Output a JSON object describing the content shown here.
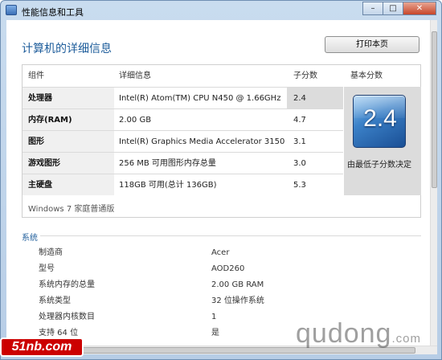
{
  "window": {
    "title": "性能信息和工具",
    "min": "–",
    "max": "□",
    "close": "✕"
  },
  "heading": "计算机的详细信息",
  "print_button": "打印本页",
  "table": {
    "headers": {
      "component": "组件",
      "details": "详细信息",
      "subscore": "子分数",
      "basescore": "基本分数"
    },
    "rows": [
      {
        "component": "处理器",
        "details": "Intel(R) Atom(TM) CPU N450 @ 1.66GHz",
        "subscore": "2.4"
      },
      {
        "component": "内存(RAM)",
        "details": "2.00 GB",
        "subscore": "4.7"
      },
      {
        "component": "图形",
        "details": "Intel(R) Graphics Media Accelerator 3150",
        "subscore": "3.1"
      },
      {
        "component": "游戏图形",
        "details": "256 MB 可用图形内存总量",
        "subscore": "3.0"
      },
      {
        "component": "主硬盘",
        "details": "118GB 可用(总计 136GB)",
        "subscore": "5.3"
      }
    ],
    "base_score": "2.4",
    "base_caption": "由最低子分数决定",
    "edition": "Windows 7 家庭普通版"
  },
  "system": {
    "title": "系统",
    "rows": [
      {
        "label": "制造商",
        "value": "Acer"
      },
      {
        "label": "型号",
        "value": "AOD260"
      },
      {
        "label": "系统内存的总量",
        "value": "2.00 GB RAM"
      },
      {
        "label": "系统类型",
        "value": "32 位操作系统"
      },
      {
        "label": "处理器内核数目",
        "value": "1"
      },
      {
        "label": "支持 64 位",
        "value": "是"
      }
    ]
  },
  "watermarks": {
    "left": "51nb.com",
    "right_main": "qudong",
    "right_suffix": ".com"
  }
}
